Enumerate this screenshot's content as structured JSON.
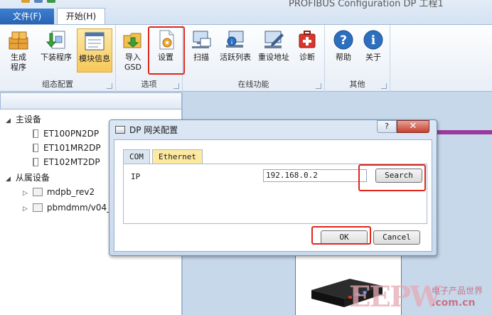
{
  "window": {
    "title": "PROFIBUS Configuration DP 工程1"
  },
  "ribbon": {
    "tabs": [
      {
        "label": "文件(F)"
      },
      {
        "label": "开始(H)"
      }
    ],
    "groups": [
      {
        "label": "组态配置",
        "buttons": [
          {
            "label": "生成\n程序"
          },
          {
            "label": "下装程序"
          },
          {
            "label": "模块信息"
          }
        ]
      },
      {
        "label": "选项",
        "buttons": [
          {
            "label": "导入\nGSD"
          },
          {
            "label": "设置"
          }
        ]
      },
      {
        "label": "在线功能",
        "buttons": [
          {
            "label": "扫描"
          },
          {
            "label": "活跃列表"
          },
          {
            "label": "重设地址"
          },
          {
            "label": "诊断"
          }
        ]
      },
      {
        "label": "其他",
        "buttons": [
          {
            "label": "帮助"
          },
          {
            "label": "关于"
          }
        ]
      }
    ]
  },
  "tree": {
    "master": "主设备",
    "master_children": [
      "ET100PN2DP",
      "ET101MR2DP",
      "ET102MT2DP"
    ],
    "slave": "从属设备",
    "slave_children": [
      "mdpb_rev2",
      "pbmdmm/v04_"
    ]
  },
  "dialog": {
    "title": "DP 网关配置",
    "help_label": "?",
    "close_label": "✕",
    "tabs": [
      {
        "label": "COM"
      },
      {
        "label": "Ethernet"
      }
    ],
    "ip_label": "IP",
    "ip_value": "192.168.0.2",
    "search_label": "Search",
    "ok_label": "OK",
    "cancel_label": "Cancel"
  },
  "watermark": {
    "logo": "EEPW",
    "cn": "电子产品世界",
    "domain": ".com.cn"
  },
  "colors": {
    "highlight": "#e0261b",
    "file_tab": "#2a63b4",
    "active_button": "#f7c85a",
    "close_button": "#c6402f"
  }
}
